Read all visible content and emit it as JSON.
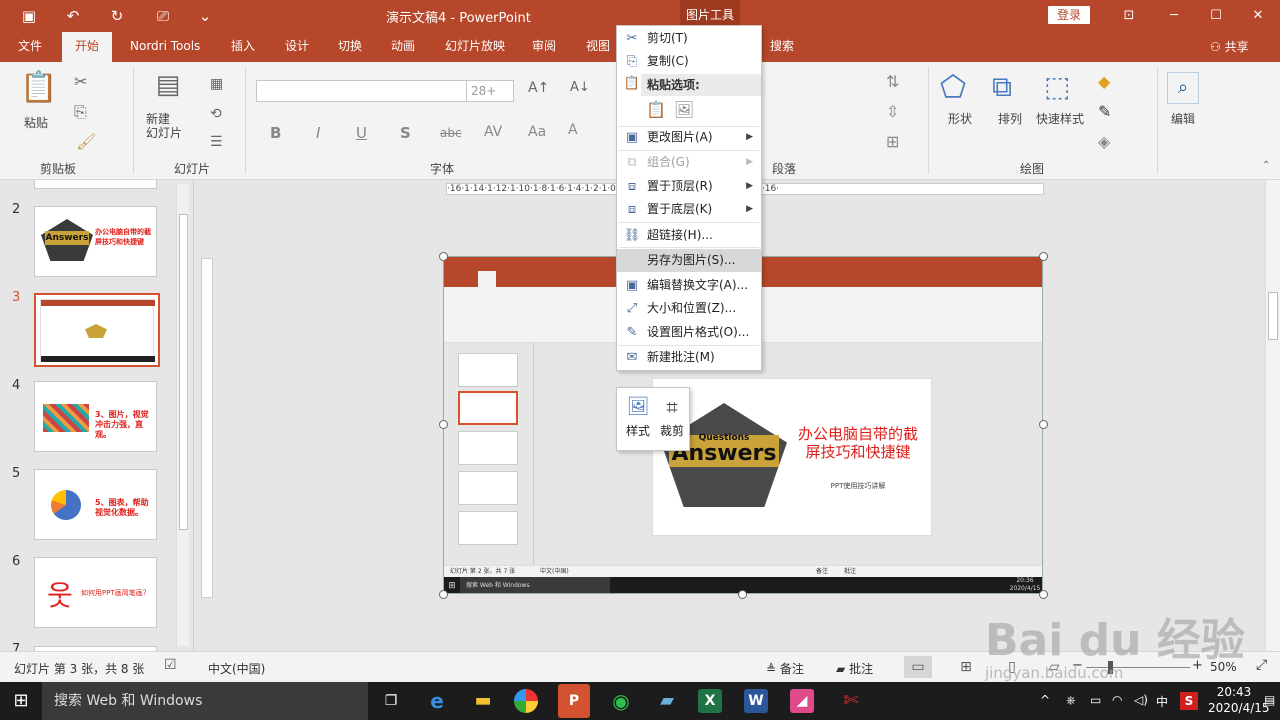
{
  "titlebar": {
    "title": "演示文稿4 - PowerPoint",
    "context_tab": "图片工具",
    "login": "登录",
    "quick_access": [
      {
        "name": "save-icon",
        "glyph": "🖫"
      },
      {
        "name": "undo-icon",
        "glyph": "↶"
      },
      {
        "name": "redo-icon",
        "glyph": "↻"
      },
      {
        "name": "slideshow-icon",
        "glyph": "⎚"
      },
      {
        "name": "customize-icon",
        "glyph": "⌄"
      }
    ],
    "window_buttons": [
      {
        "name": "ribbon-display-icon",
        "glyph": "⊡"
      },
      {
        "name": "minimize-icon",
        "glyph": "─"
      },
      {
        "name": "maximize-icon",
        "glyph": "☐"
      },
      {
        "name": "close-icon",
        "glyph": "✕"
      }
    ]
  },
  "tabs": {
    "items": [
      "文件",
      "开始",
      "Nordri Tools",
      "插入",
      "设计",
      "切换",
      "动画",
      "幻灯片放映",
      "审阅",
      "视图",
      "搜索"
    ],
    "active": "开始",
    "share": "共享"
  },
  "ribbon": {
    "paste": "粘贴",
    "new_slide": "新建\n幻灯片",
    "groups": [
      "剪贴板",
      "幻灯片",
      "字体",
      "段落",
      "绘图"
    ],
    "font_size": "28+",
    "font_buttons": [
      "B",
      "I",
      "U",
      "S",
      "abc",
      "AV",
      "Aa",
      "A"
    ],
    "shape": "形状",
    "arrange": "排列",
    "quick_styles": "快速样式",
    "edit": "编辑"
  },
  "thumbnails": [
    {
      "num": "7",
      "title": ""
    },
    {
      "num": "2",
      "title": "办公电脑自带的截屏技巧和快捷键"
    },
    {
      "num": "3",
      "title": ""
    },
    {
      "num": "4",
      "title": "3、图片，视觉冲击力强，直观。"
    },
    {
      "num": "5",
      "title": "5、图表，帮助视觉化数据。"
    },
    {
      "num": "6",
      "title": "如何用PPT画简笔画？"
    },
    {
      "num": "7",
      "title": ""
    }
  ],
  "ruler": {
    "horizontal": "·16·1·14·1·12·1·10·1·8·1·6·1·4·1·2·1·0·1·2·1·4·1·6·1·8·1·10·1·12·1·14·1·16·"
  },
  "context_menu": {
    "items": [
      {
        "label": "剪切(T)",
        "icon": "scissors-icon",
        "glyph": "✂",
        "disabled": false,
        "submenu": false
      },
      {
        "label": "复制(C)",
        "icon": "copy-icon",
        "glyph": "⎘",
        "disabled": false,
        "submenu": false
      },
      {
        "label": "更改图片(A)",
        "icon": "change-picture-icon",
        "glyph": "🖼",
        "disabled": false,
        "submenu": true
      },
      {
        "label": "组合(G)",
        "icon": "group-icon",
        "glyph": "⧉",
        "disabled": true,
        "submenu": true
      },
      {
        "label": "置于顶层(R)",
        "icon": "bring-front-icon",
        "glyph": "⧈",
        "disabled": false,
        "submenu": true
      },
      {
        "label": "置于底层(K)",
        "icon": "send-back-icon",
        "glyph": "⧈",
        "disabled": false,
        "submenu": true
      },
      {
        "label": "超链接(H)...",
        "icon": "hyperlink-icon",
        "glyph": "⛓",
        "disabled": false,
        "submenu": false
      },
      {
        "label": "另存为图片(S)...",
        "icon": "",
        "glyph": "",
        "disabled": false,
        "submenu": false
      },
      {
        "label": "编辑替换文字(A)...",
        "icon": "alt-text-icon",
        "glyph": "▣",
        "disabled": false,
        "submenu": false
      },
      {
        "label": "大小和位置(Z)...",
        "icon": "size-position-icon",
        "glyph": "⤢",
        "disabled": false,
        "submenu": false
      },
      {
        "label": "设置图片格式(O)...",
        "icon": "format-picture-icon",
        "glyph": "✎",
        "disabled": false,
        "submenu": false
      },
      {
        "label": "新建批注(M)",
        "icon": "comment-icon",
        "glyph": "✉",
        "disabled": false,
        "submenu": false
      }
    ],
    "paste_header": "粘贴选项:",
    "highlighted": "另存为图片(S)..."
  },
  "mini_toolbar": {
    "style": "样式",
    "crop": "裁剪"
  },
  "slide": {
    "title": "办公电脑自带的截屏技巧和快捷键",
    "subtitle": "PPT使用技巧讲解",
    "image_top": "Questions",
    "image_main": "Answers",
    "inner_status": "幻灯片 第 2 张，共 7 张",
    "inner_lang": "中文(中国)",
    "inner_notes": "备注",
    "inner_comments": "批注",
    "inner_search": "搜索 Web 和 Windows",
    "inner_time": "20:36",
    "inner_date": "2020/4/15"
  },
  "status": {
    "slide_info": "幻灯片 第 3 张，共 8 张",
    "language": "中文(中国)",
    "notes": "备注",
    "comments": "批注",
    "zoom": "50%"
  },
  "taskbar": {
    "search": "搜索 Web 和 Windows",
    "time": "20:43",
    "date": "2020/4/15",
    "ime": "中"
  },
  "watermark": {
    "brand": "Bai du 经验",
    "url": "jingyan.baidu.com"
  },
  "colors": {
    "accent": "#b7472a",
    "highlight_red": "#e0201c",
    "selection_border": "#d35230"
  }
}
